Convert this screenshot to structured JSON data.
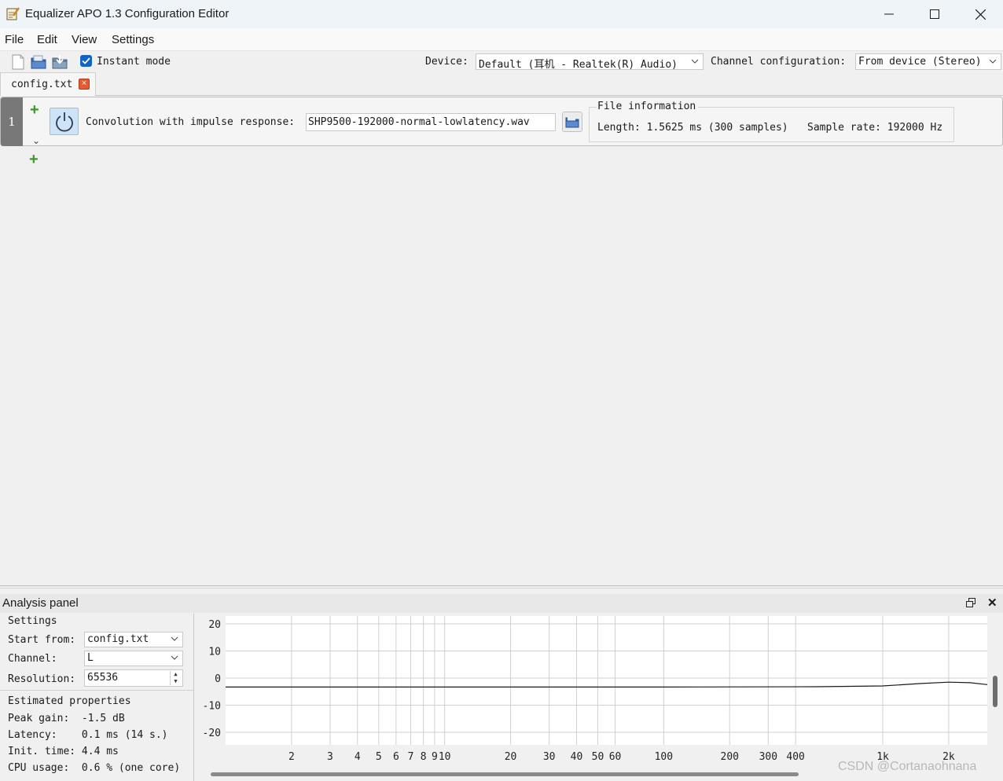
{
  "window": {
    "title": "Equalizer APO 1.3 Configuration Editor"
  },
  "menu": [
    "File",
    "Edit",
    "View",
    "Settings"
  ],
  "toolbar": {
    "instant_mode_label": "Instant mode",
    "instant_mode_checked": true,
    "device_label": "Device:",
    "device_value": "Default (耳机 - Realtek(R) Audio)",
    "channel_config_label": "Channel configuration:",
    "channel_config_value": "From device (Stereo)"
  },
  "tabs": [
    {
      "label": "config.txt",
      "active": true
    }
  ],
  "filter": {
    "index": "1",
    "enabled": true,
    "type_label": "Convolution with impulse response:",
    "file": "SHP9500-192000-normal-lowlatency.wav",
    "file_info_title": "File information",
    "length": "Length: 1.5625 ms (300 samples)",
    "sample_rate": "Sample rate: 192000 Hz"
  },
  "analysis": {
    "title": "Analysis panel",
    "settings_title": "Settings",
    "start_from_label": "Start from:",
    "start_from_value": "config.txt",
    "channel_label": "Channel:",
    "channel_value": "L",
    "resolution_label": "Resolution:",
    "resolution_value": "65536",
    "estimated_title": "Estimated properties",
    "peak_gain": "Peak gain:  -1.5 dB",
    "latency": "Latency:    0.1 ms (14 s.)",
    "init_time": "Init. time: 4.4 ms",
    "cpu_usage": "CPU usage:  0.6 % (one core)"
  },
  "chart_data": {
    "type": "line",
    "xscale": "log",
    "x_ticks": [
      "2",
      "3",
      "4",
      "5",
      "6",
      "7",
      "8",
      "9",
      "10",
      "20",
      "30",
      "40",
      "50",
      "60",
      "100",
      "200",
      "300",
      "400",
      "1k",
      "2k"
    ],
    "y_ticks": [
      "20",
      "10",
      "0",
      "-10",
      "-20"
    ],
    "xlim": [
      1,
      3000
    ],
    "ylim": [
      -25,
      25
    ],
    "grid": true,
    "series": [
      {
        "x": [
          1,
          10,
          100,
          500,
          1000,
          1500,
          2000,
          2500,
          3000
        ],
        "y": [
          -3.3,
          -3.3,
          -3.3,
          -3.2,
          -2.9,
          -2.0,
          -1.5,
          -1.7,
          -2.4
        ]
      }
    ]
  },
  "watermark": "CSDN @Cortanaohnana",
  "colors": {
    "checkbox": "#1164c3",
    "add_icon": "#3c9a28",
    "tab_close": "#e65a32",
    "power_button_bg": "#cde3f7"
  }
}
